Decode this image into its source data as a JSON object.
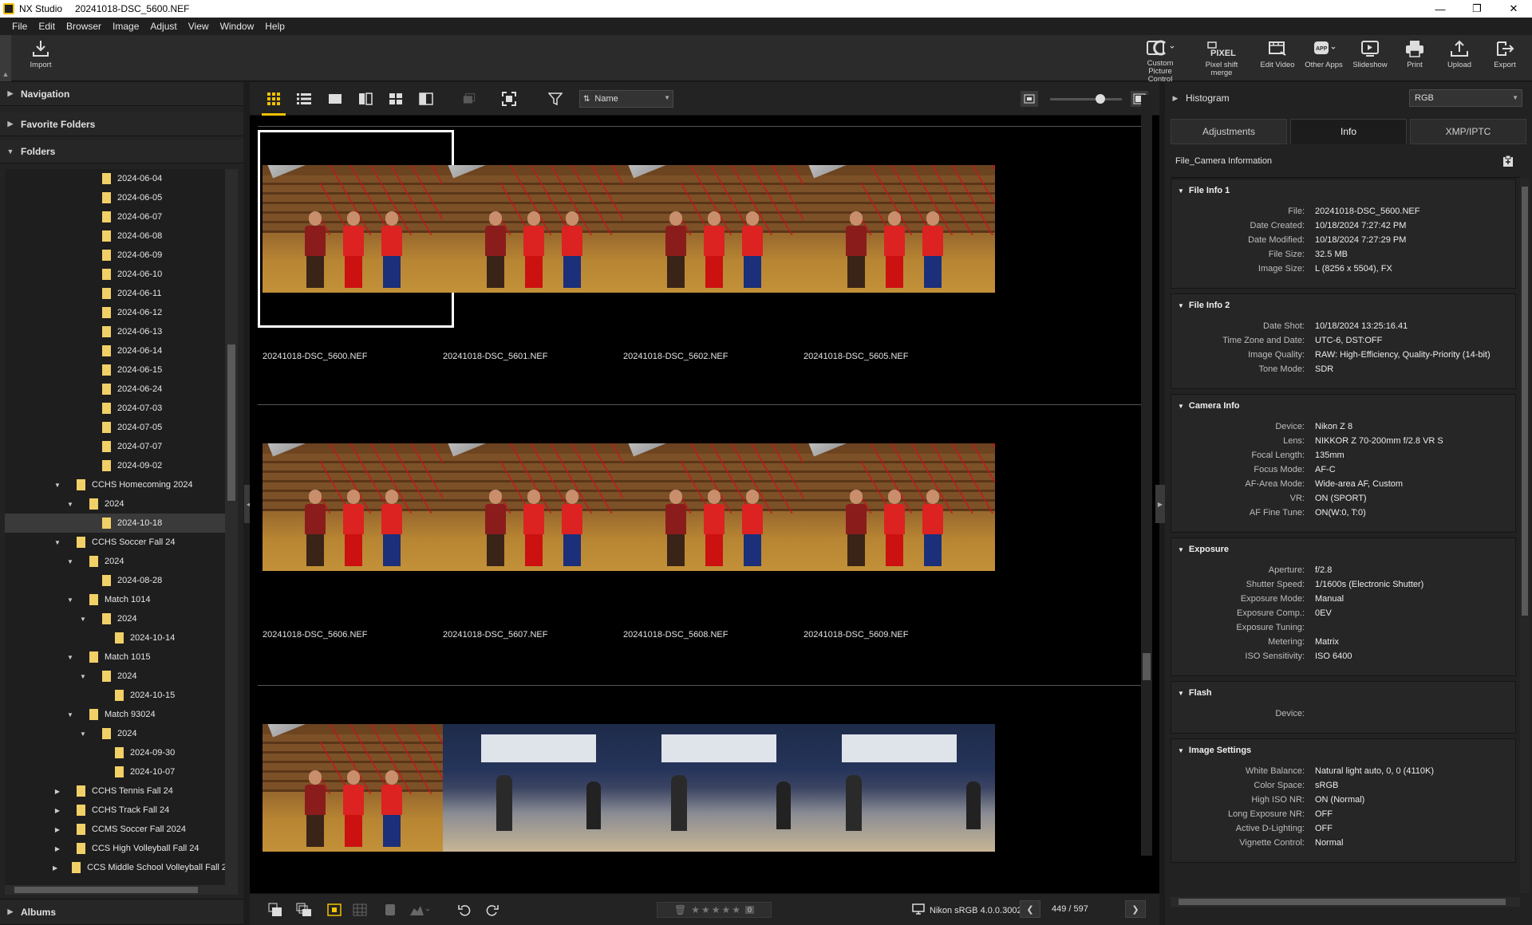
{
  "titlebar": {
    "app": "NX Studio",
    "document": "20241018-DSC_5600.NEF"
  },
  "menu": [
    "File",
    "Edit",
    "Browser",
    "Image",
    "Adjust",
    "View",
    "Window",
    "Help"
  ],
  "toolbar": {
    "import": "Import",
    "tools": [
      {
        "label": "Custom Picture Control",
        "icon": "picture-control-icon"
      },
      {
        "label": "Pixel shift merge",
        "icon": "pixel-icon"
      },
      {
        "label": "Edit Video",
        "icon": "video-edit-icon"
      },
      {
        "label": "Other Apps",
        "icon": "app-icon"
      },
      {
        "label": "Slideshow",
        "icon": "slideshow-icon"
      },
      {
        "label": "Print",
        "icon": "print-icon"
      },
      {
        "label": "Upload",
        "icon": "upload-icon"
      },
      {
        "label": "Export",
        "icon": "export-icon"
      }
    ]
  },
  "left": {
    "navigation": "Navigation",
    "favorites": "Favorite Folders",
    "folders": "Folders",
    "albums": "Albums",
    "tree": [
      {
        "label": "2024-06-04",
        "depth": 2,
        "exp": ""
      },
      {
        "label": "2024-06-05",
        "depth": 2,
        "exp": ""
      },
      {
        "label": "2024-06-07",
        "depth": 2,
        "exp": ""
      },
      {
        "label": "2024-06-08",
        "depth": 2,
        "exp": ""
      },
      {
        "label": "2024-06-09",
        "depth": 2,
        "exp": ""
      },
      {
        "label": "2024-06-10",
        "depth": 2,
        "exp": ""
      },
      {
        "label": "2024-06-11",
        "depth": 2,
        "exp": ""
      },
      {
        "label": "2024-06-12",
        "depth": 2,
        "exp": ""
      },
      {
        "label": "2024-06-13",
        "depth": 2,
        "exp": ""
      },
      {
        "label": "2024-06-14",
        "depth": 2,
        "exp": ""
      },
      {
        "label": "2024-06-15",
        "depth": 2,
        "exp": ""
      },
      {
        "label": "2024-06-24",
        "depth": 2,
        "exp": ""
      },
      {
        "label": "2024-07-03",
        "depth": 2,
        "exp": ""
      },
      {
        "label": "2024-07-05",
        "depth": 2,
        "exp": ""
      },
      {
        "label": "2024-07-07",
        "depth": 2,
        "exp": ""
      },
      {
        "label": "2024-09-02",
        "depth": 2,
        "exp": ""
      },
      {
        "label": "CCHS Homecoming 2024",
        "depth": 0,
        "exp": "▼"
      },
      {
        "label": "2024",
        "depth": 1,
        "exp": "▼"
      },
      {
        "label": "2024-10-18",
        "depth": 2,
        "exp": "",
        "selected": true
      },
      {
        "label": "CCHS Soccer Fall 24",
        "depth": 0,
        "exp": "▼"
      },
      {
        "label": "2024",
        "depth": 1,
        "exp": "▼"
      },
      {
        "label": "2024-08-28",
        "depth": 2,
        "exp": ""
      },
      {
        "label": "Match 1014",
        "depth": 1,
        "exp": "▼"
      },
      {
        "label": "2024",
        "depth": 2,
        "exp": "▼"
      },
      {
        "label": "2024-10-14",
        "depth": 3,
        "exp": ""
      },
      {
        "label": "Match 1015",
        "depth": 1,
        "exp": "▼"
      },
      {
        "label": "2024",
        "depth": 2,
        "exp": "▼"
      },
      {
        "label": "2024-10-15",
        "depth": 3,
        "exp": ""
      },
      {
        "label": "Match 93024",
        "depth": 1,
        "exp": "▼"
      },
      {
        "label": "2024",
        "depth": 2,
        "exp": "▼"
      },
      {
        "label": "2024-09-30",
        "depth": 3,
        "exp": ""
      },
      {
        "label": "2024-10-07",
        "depth": 3,
        "exp": ""
      },
      {
        "label": "CCHS Tennis Fall 24",
        "depth": 0,
        "exp": "▶"
      },
      {
        "label": "CCHS Track Fall 24",
        "depth": 0,
        "exp": "▶"
      },
      {
        "label": "CCMS Soccer Fall 2024",
        "depth": 0,
        "exp": "▶"
      },
      {
        "label": "CCS High Volleyball Fall 24",
        "depth": 0,
        "exp": "▶"
      },
      {
        "label": "CCS Middle School Volleyball Fall 2",
        "depth": 0,
        "exp": "▶"
      }
    ]
  },
  "browser": {
    "sort": "Name",
    "thumbs": [
      {
        "name": "20241018-DSC_5600.NEF",
        "kind": "group",
        "selected": true
      },
      {
        "name": "20241018-DSC_5601.NEF",
        "kind": "group"
      },
      {
        "name": "20241018-DSC_5602.NEF",
        "kind": "group"
      },
      {
        "name": "20241018-DSC_5605.NEF",
        "kind": "group"
      },
      {
        "name": "20241018-DSC_5606.NEF",
        "kind": "group"
      },
      {
        "name": "20241018-DSC_5607.NEF",
        "kind": "group"
      },
      {
        "name": "20241018-DSC_5608.NEF",
        "kind": "group"
      },
      {
        "name": "20241018-DSC_5609.NEF",
        "kind": "group"
      },
      {
        "name": "",
        "kind": "group"
      },
      {
        "name": "",
        "kind": "volley"
      },
      {
        "name": "",
        "kind": "volley"
      },
      {
        "name": "",
        "kind": "volley"
      }
    ],
    "profile": "Nikon sRGB 4.0.0.3002",
    "counter": "449 / 597"
  },
  "right": {
    "histogram": "Histogram",
    "channel": "RGB",
    "tabs": [
      "Adjustments",
      "Info",
      "XMP/IPTC"
    ],
    "active_tab": "Info",
    "panel_title": "File_Camera Information",
    "sections": [
      {
        "title": "File Info 1",
        "rows": [
          [
            "File:",
            "20241018-DSC_5600.NEF"
          ],
          [
            "Date Created:",
            "10/18/2024 7:27:42 PM"
          ],
          [
            "Date Modified:",
            "10/18/2024 7:27:29 PM"
          ],
          [
            "File Size:",
            "32.5 MB"
          ],
          [
            "Image Size:",
            "L (8256 x 5504), FX"
          ]
        ]
      },
      {
        "title": "File Info 2",
        "rows": [
          [
            "Date Shot:",
            "10/18/2024 13:25:16.41"
          ],
          [
            "Time Zone and Date:",
            "UTC-6, DST:OFF"
          ],
          [
            "Image Quality:",
            "RAW: High-Efficiency, Quality-Priority (14-bit)"
          ],
          [
            "Tone Mode:",
            "SDR"
          ]
        ]
      },
      {
        "title": "Camera Info",
        "rows": [
          [
            "Device:",
            "Nikon Z 8"
          ],
          [
            "Lens:",
            "NIKKOR Z 70-200mm f/2.8 VR S"
          ],
          [
            "Focal Length:",
            "135mm"
          ],
          [
            "Focus Mode:",
            "AF-C"
          ],
          [
            "AF-Area Mode:",
            "Wide-area AF, Custom"
          ],
          [
            "VR:",
            "ON (SPORT)"
          ],
          [
            "AF Fine Tune:",
            "ON(W:0, T:0)"
          ]
        ]
      },
      {
        "title": "Exposure",
        "rows": [
          [
            "Aperture:",
            "f/2.8"
          ],
          [
            "Shutter Speed:",
            "1/1600s (Electronic Shutter)"
          ],
          [
            "Exposure Mode:",
            "Manual"
          ],
          [
            "Exposure Comp.:",
            "0EV"
          ],
          [
            "Exposure Tuning:",
            ""
          ],
          [
            "Metering:",
            "Matrix"
          ],
          [
            "ISO Sensitivity:",
            "ISO 6400"
          ]
        ]
      },
      {
        "title": "Flash",
        "rows": [
          [
            "Device:",
            ""
          ]
        ]
      },
      {
        "title": "Image Settings",
        "rows": [
          [
            "White Balance:",
            "Natural light auto, 0, 0 (4110K)"
          ],
          [
            "Color Space:",
            "sRGB"
          ],
          [
            "High ISO NR:",
            "ON (Normal)"
          ],
          [
            "Long Exposure NR:",
            "OFF"
          ],
          [
            "Active D-Lighting:",
            "OFF"
          ],
          [
            "Vignette Control:",
            "Normal"
          ]
        ]
      }
    ]
  },
  "colors": {
    "accent": "#f4c200",
    "folder": "#f1d067",
    "background": "#000000"
  }
}
